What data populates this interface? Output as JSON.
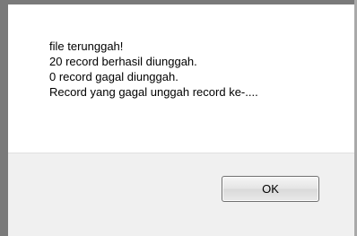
{
  "dialog": {
    "message_lines": [
      "file terunggah!",
      "20 record berhasil diunggah.",
      "0 record gagal diunggah.",
      "Record yang gagal unggah record ke-...."
    ],
    "ok_label": "OK"
  },
  "colors": {
    "frame": "#7a7a7a",
    "content_bg": "#ffffff",
    "button_area_bg": "#f0f0f0",
    "button_border": "#707070"
  }
}
